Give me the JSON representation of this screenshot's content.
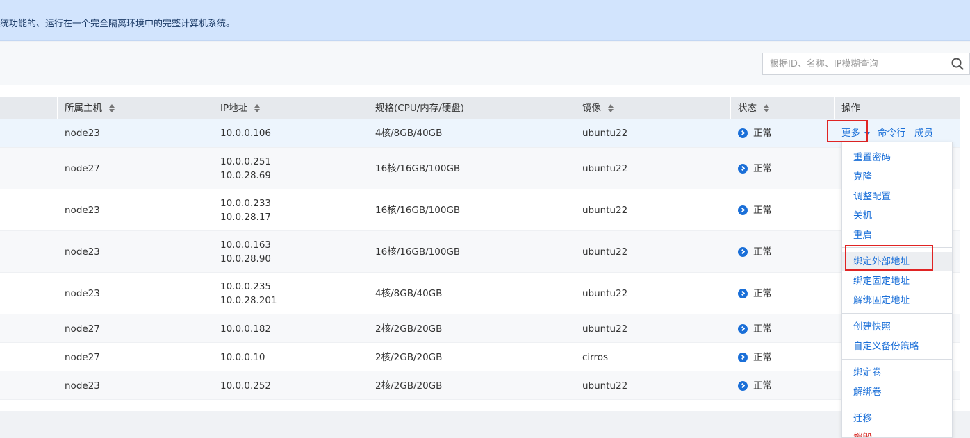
{
  "banner": {
    "text": "统功能的、运行在一个完全隔离环境中的完整计算机系统。"
  },
  "search": {
    "placeholder": "根据ID、名称、IP模糊查询",
    "icon": "search-icon"
  },
  "table": {
    "columns": [
      "所属主机",
      "IP地址",
      "规格(CPU/内存/硬盘)",
      "镜像",
      "状态",
      "操作"
    ],
    "rows": [
      {
        "host": "node23",
        "ip1": "10.0.0.106",
        "ip2": "",
        "spec": "4核/8GB/40GB",
        "image": "ubuntu22",
        "status": "正常"
      },
      {
        "host": "node27",
        "ip1": "10.0.0.251",
        "ip2": "10.0.28.69",
        "spec": "16核/16GB/100GB",
        "image": "ubuntu22",
        "status": "正常"
      },
      {
        "host": "node23",
        "ip1": "10.0.0.233",
        "ip2": "10.0.28.17",
        "spec": "16核/16GB/100GB",
        "image": "ubuntu22",
        "status": "正常"
      },
      {
        "host": "node23",
        "ip1": "10.0.0.163",
        "ip2": "10.0.28.90",
        "spec": "16核/16GB/100GB",
        "image": "ubuntu22",
        "status": "正常"
      },
      {
        "host": "node23",
        "ip1": "10.0.0.235",
        "ip2": "10.0.28.201",
        "spec": "4核/8GB/40GB",
        "image": "ubuntu22",
        "status": "正常"
      },
      {
        "host": "node27",
        "ip1": "10.0.0.182",
        "ip2": "",
        "spec": "2核/2GB/20GB",
        "image": "ubuntu22",
        "status": "正常"
      },
      {
        "host": "node27",
        "ip1": "10.0.0.10",
        "ip2": "",
        "spec": "2核/2GB/20GB",
        "image": "cirros",
        "status": "正常"
      },
      {
        "host": "node23",
        "ip1": "10.0.0.252",
        "ip2": "",
        "spec": "2核/2GB/20GB",
        "image": "ubuntu22",
        "status": "正常"
      }
    ],
    "actions": {
      "more": "更多",
      "console": "命令行",
      "members": "成员"
    }
  },
  "dropdown": {
    "items": [
      "重置密码",
      "克隆",
      "调整配置",
      "关机",
      "重启",
      "绑定外部地址",
      "绑定固定地址",
      "解绑固定地址",
      "创建快照",
      "自定义备份策略",
      "绑定卷",
      "解绑卷",
      "迁移",
      "销毁"
    ],
    "active": "绑定外部地址"
  },
  "colors": {
    "accent": "#1a6fd8",
    "highlight_box": "#e02424",
    "banner_bg": "#d2e4fd"
  }
}
